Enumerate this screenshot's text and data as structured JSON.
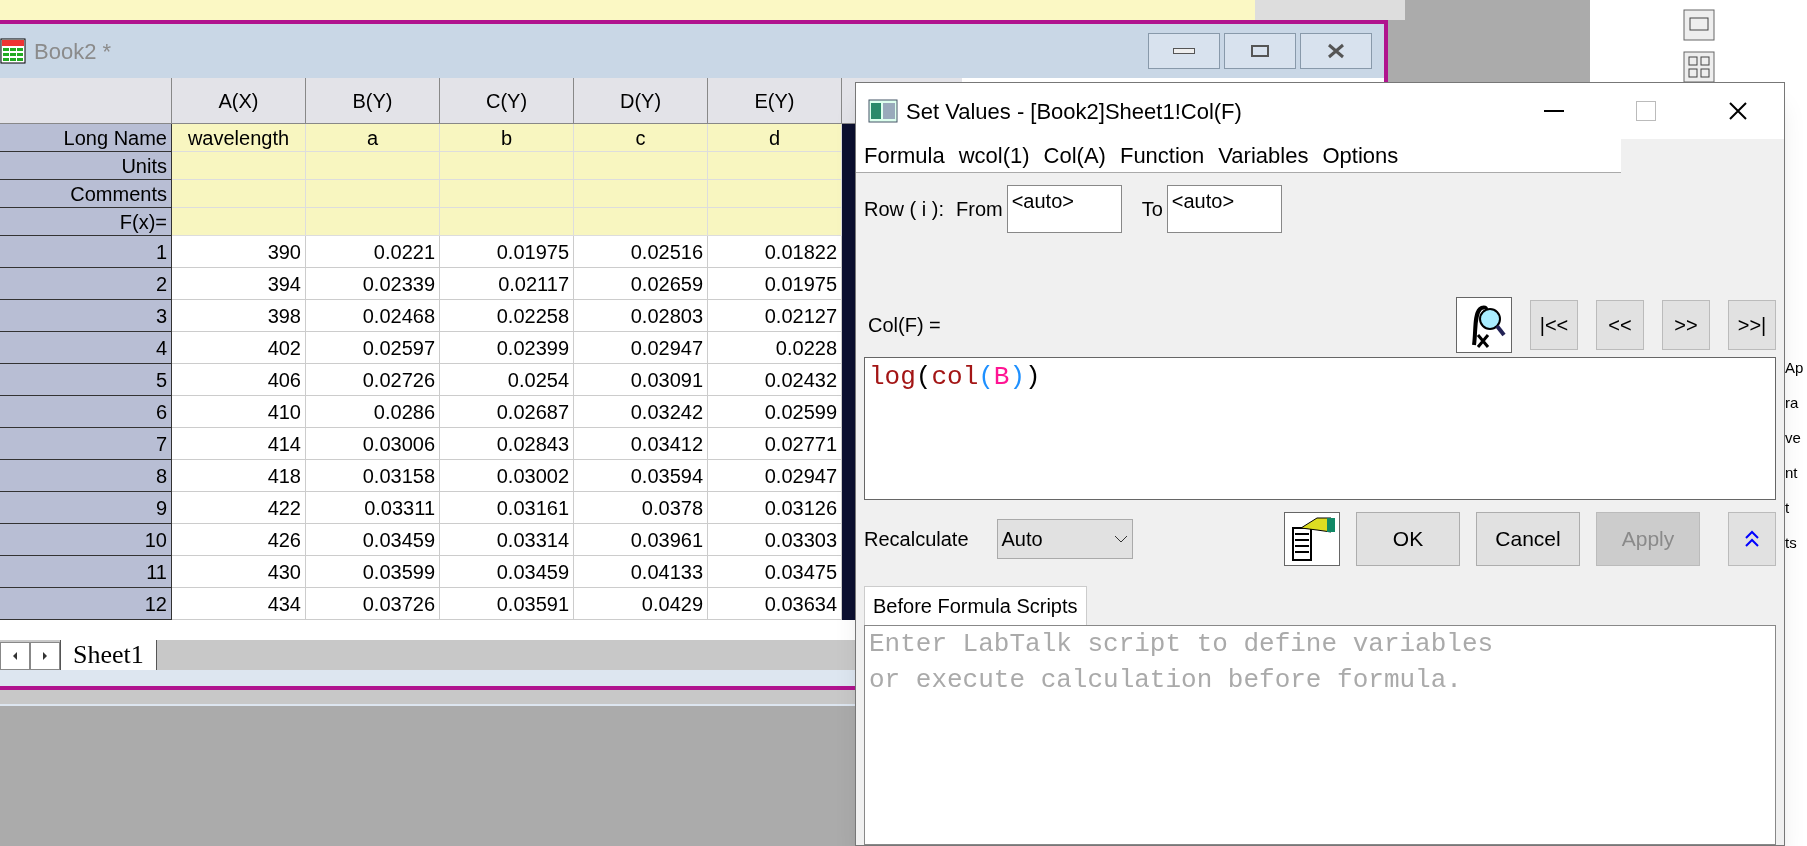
{
  "worksheet": {
    "title": "Book2 *",
    "columns": [
      "A(X)",
      "B(Y)",
      "C(Y)",
      "D(Y)",
      "E(Y)"
    ],
    "label_rows": [
      {
        "label": "Long Name",
        "values": [
          "wavelength",
          "a",
          "b",
          "c",
          "d"
        ]
      },
      {
        "label": "Units",
        "values": []
      },
      {
        "label": "Comments",
        "values": []
      },
      {
        "label": "F(x)=",
        "values": []
      }
    ],
    "rows": [
      {
        "number": "1",
        "cells": [
          "390",
          "0.0221",
          "0.01975",
          "0.02516",
          "0.01822"
        ]
      },
      {
        "number": "2",
        "cells": [
          "394",
          "0.02339",
          "0.02117",
          "0.02659",
          "0.01975"
        ]
      },
      {
        "number": "3",
        "cells": [
          "398",
          "0.02468",
          "0.02258",
          "0.02803",
          "0.02127"
        ]
      },
      {
        "number": "4",
        "cells": [
          "402",
          "0.02597",
          "0.02399",
          "0.02947",
          "0.0228"
        ]
      },
      {
        "number": "5",
        "cells": [
          "406",
          "0.02726",
          "0.0254",
          "0.03091",
          "0.02432"
        ]
      },
      {
        "number": "6",
        "cells": [
          "410",
          "0.0286",
          "0.02687",
          "0.03242",
          "0.02599"
        ]
      },
      {
        "number": "7",
        "cells": [
          "414",
          "0.03006",
          "0.02843",
          "0.03412",
          "0.02771"
        ]
      },
      {
        "number": "8",
        "cells": [
          "418",
          "0.03158",
          "0.03002",
          "0.03594",
          "0.02947"
        ]
      },
      {
        "number": "9",
        "cells": [
          "422",
          "0.03311",
          "0.03161",
          "0.0378",
          "0.03126"
        ]
      },
      {
        "number": "10",
        "cells": [
          "426",
          "0.03459",
          "0.03314",
          "0.03961",
          "0.03303"
        ]
      },
      {
        "number": "11",
        "cells": [
          "430",
          "0.03599",
          "0.03459",
          "0.04133",
          "0.03475"
        ]
      },
      {
        "number": "12",
        "cells": [
          "434",
          "0.03726",
          "0.03591",
          "0.0429",
          "0.03634"
        ]
      }
    ],
    "sheet_tabs": [
      {
        "label": "Sheet1",
        "selected": true
      }
    ]
  },
  "dialog": {
    "title": "Set Values - [Book2]Sheet1!Col(F)",
    "menu": [
      "Formula",
      "wcol(1)",
      "Col(A)",
      "Function",
      "Variables",
      "Options"
    ],
    "row_label": "Row ( i ):",
    "from_label": "From",
    "from_value": "<auto>",
    "to_label": "To",
    "to_value": "<auto>",
    "formula_label": "Col(F) =",
    "nav_buttons": [
      "|<<",
      "<<",
      ">>",
      ">>|"
    ],
    "formula_tokens": [
      {
        "text": "log",
        "kind": "function"
      },
      {
        "text": "(",
        "kind": "paren"
      },
      {
        "text": "col",
        "kind": "function"
      },
      {
        "text": "(",
        "kind": "inner_paren"
      },
      {
        "text": "B",
        "kind": "argument"
      },
      {
        "text": ")",
        "kind": "inner_paren"
      },
      {
        "text": ")",
        "kind": "paren"
      }
    ],
    "recalculate_label": "Recalculate",
    "recalculate_value": "Auto",
    "buttons": [
      {
        "label": "OK",
        "disabled": false
      },
      {
        "label": "Cancel",
        "disabled": false
      },
      {
        "label": "Apply",
        "disabled": true
      }
    ],
    "script_tab": "Before Formula Scripts",
    "script_placeholder": "Enter LabTalk script to define variables\nor execute calculation before formula."
  },
  "right_edge_fragments": [
    "Ap",
    "ra",
    "ve",
    "nt",
    "t",
    "ts"
  ]
}
